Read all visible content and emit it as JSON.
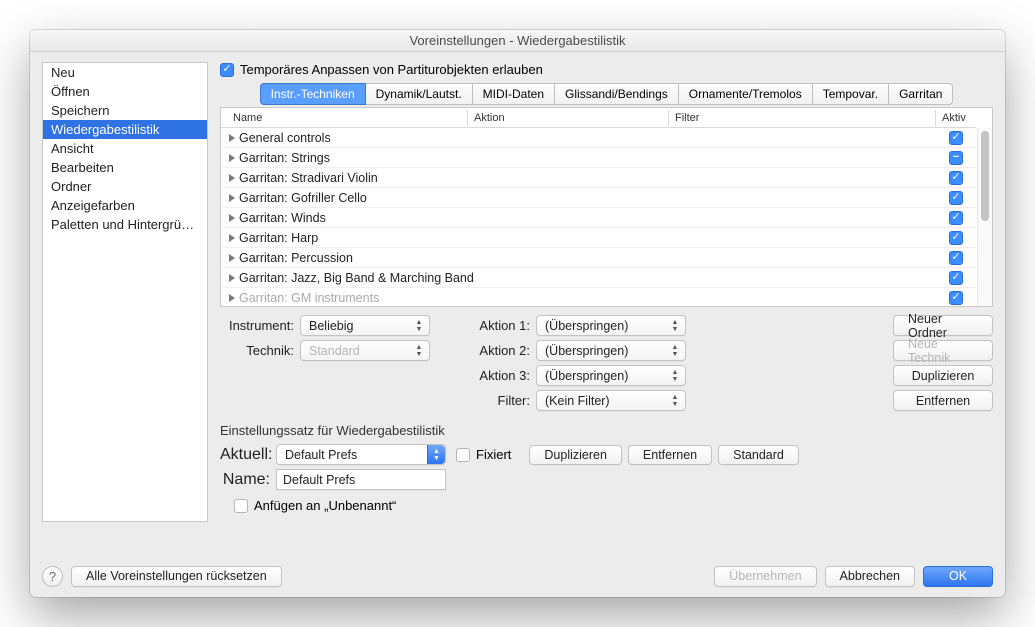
{
  "window": {
    "title": "Voreinstellungen - Wiedergabestilistik"
  },
  "sidebar": {
    "items": [
      {
        "label": "Neu",
        "selected": false
      },
      {
        "label": "Öffnen",
        "selected": false
      },
      {
        "label": "Speichern",
        "selected": false
      },
      {
        "label": "Wiedergabestilistik",
        "selected": true
      },
      {
        "label": "Ansicht",
        "selected": false
      },
      {
        "label": "Bearbeiten",
        "selected": false
      },
      {
        "label": "Ordner",
        "selected": false
      },
      {
        "label": "Anzeigefarben",
        "selected": false
      },
      {
        "label": "Paletten und Hintergründe",
        "selected": false
      }
    ]
  },
  "main": {
    "allow_temp": {
      "label": "Temporäres Anpassen von Partiturobjekten erlauben",
      "checked": true
    },
    "tabs": [
      {
        "label": "Instr.-Techniken",
        "active": true
      },
      {
        "label": "Dynamik/Lautst.",
        "active": false
      },
      {
        "label": "MIDI-Daten",
        "active": false
      },
      {
        "label": "Glissandi/Bendings",
        "active": false
      },
      {
        "label": "Ornamente/Tremolos",
        "active": false
      },
      {
        "label": "Tempovar.",
        "active": false
      },
      {
        "label": "Garritan",
        "active": false
      }
    ],
    "columns": {
      "name": "Name",
      "aktion": "Aktion",
      "filter": "Filter",
      "aktiv": "Aktiv"
    },
    "rows": [
      {
        "name": "General controls",
        "state": "checked"
      },
      {
        "name": "Garritan: Strings",
        "state": "indet"
      },
      {
        "name": "Garritan: Stradivari Violin",
        "state": "checked"
      },
      {
        "name": "Garritan: Gofriller Cello",
        "state": "checked"
      },
      {
        "name": "Garritan: Winds",
        "state": "checked"
      },
      {
        "name": "Garritan: Harp",
        "state": "checked"
      },
      {
        "name": "Garritan: Percussion",
        "state": "checked"
      },
      {
        "name": "Garritan: Jazz, Big Band & Marching Band",
        "state": "checked"
      },
      {
        "name": "Garritan: GM instruments",
        "state": "checked",
        "faded": true
      }
    ],
    "form": {
      "instrument_label": "Instrument:",
      "instrument_value": "Beliebig",
      "technik_label": "Technik:",
      "technik_value": "Standard",
      "aktion1_label": "Aktion 1:",
      "aktion1_value": "(Überspringen)",
      "aktion2_label": "Aktion 2:",
      "aktion2_value": "(Überspringen)",
      "aktion3_label": "Aktion 3:",
      "aktion3_value": "(Überspringen)",
      "filter_label": "Filter:",
      "filter_value": "(Kein Filter)",
      "neuer_ordner": "Neuer Ordner",
      "neue_technik": "Neue Technik",
      "duplizieren": "Duplizieren",
      "entfernen": "Entfernen"
    },
    "preset": {
      "heading": "Einstellungssatz für Wiedergabestilistik",
      "aktuell_label": "Aktuell:",
      "aktuell_value": "Default Prefs",
      "fixiert_label": "Fixiert",
      "fixiert_checked": false,
      "duplizieren": "Duplizieren",
      "entfernen": "Entfernen",
      "standard": "Standard",
      "name_label": "Name:",
      "name_value": "Default Prefs",
      "anfuegen_label": "Anfügen an „Unbenannt“",
      "anfuegen_checked": false
    }
  },
  "footer": {
    "help": "?",
    "reset": "Alle Voreinstellungen rücksetzen",
    "uebernehmen": "Übernehmen",
    "abbrechen": "Abbrechen",
    "ok": "OK"
  }
}
